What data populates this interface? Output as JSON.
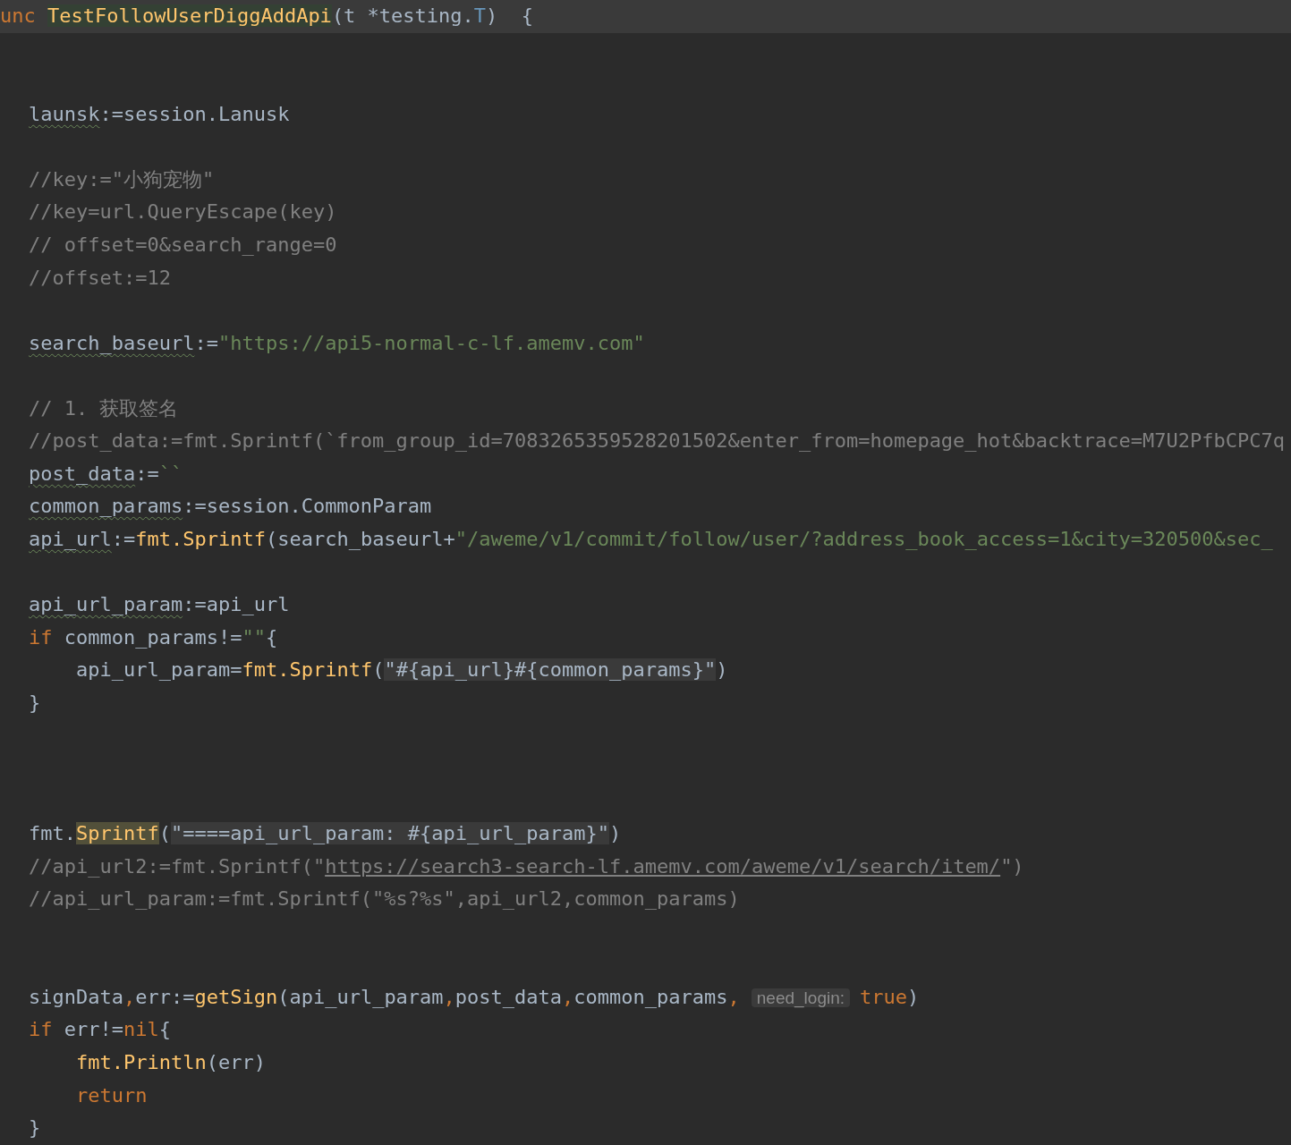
{
  "editor": {
    "lines": [
      {
        "kind": "code",
        "current": true,
        "tokens": [
          {
            "kind": "keyword",
            "text": "unc"
          },
          {
            "kind": "func-decl",
            "text": "TestFollowUserDiggAddApi"
          },
          {
            "kind": "plain",
            "text": "(t *testing."
          },
          {
            "kind": "type",
            "text": "T"
          },
          {
            "kind": "plain",
            "text": ")  {"
          }
        ],
        "children": [
          {
            "kind": "blank"
          },
          {
            "kind": "blank"
          },
          {
            "kind": "code",
            "tokens": [
              {
                "kind": "var-warn",
                "text": "launsk"
              },
              {
                "kind": "plain",
                "text": ":=session.Lanusk"
              }
            ]
          },
          {
            "kind": "blank"
          },
          {
            "kind": "code",
            "tokens": [
              {
                "kind": "comment",
                "text": "//key:=\"小狗宠物\""
              }
            ]
          },
          {
            "kind": "code",
            "tokens": [
              {
                "kind": "comment",
                "text": "//key=url.QueryEscape(key)"
              }
            ]
          },
          {
            "kind": "code",
            "tokens": [
              {
                "kind": "comment",
                "text": "// offset=0&search_range=0"
              }
            ]
          },
          {
            "kind": "code",
            "tokens": [
              {
                "kind": "comment",
                "text": "//offset:=12"
              }
            ]
          },
          {
            "kind": "blank"
          },
          {
            "kind": "code",
            "tokens": [
              {
                "kind": "var-warn",
                "text": "search_baseurl"
              },
              {
                "kind": "plain",
                "text": ":="
              },
              {
                "kind": "string",
                "text": "\"https://api5-normal-c-lf.amemv.com\""
              }
            ]
          },
          {
            "kind": "blank"
          },
          {
            "kind": "code",
            "tokens": [
              {
                "kind": "comment",
                "text": "// 1. 获取签名"
              }
            ]
          },
          {
            "kind": "code",
            "tokens": [
              {
                "kind": "comment",
                "text": "//post_data:=fmt.Sprintf(`from_group_id=7083265359528201502&enter_from=homepage_hot&backtrace=M7U2PfbCPC7q"
              }
            ]
          },
          {
            "kind": "code",
            "tokens": [
              {
                "kind": "var-warn",
                "text": "post_data"
              },
              {
                "kind": "plain",
                "text": ":="
              },
              {
                "kind": "string",
                "text": "``"
              }
            ]
          },
          {
            "kind": "code",
            "tokens": [
              {
                "kind": "var-warn",
                "text": "common_params"
              },
              {
                "kind": "plain",
                "text": ":=session.CommonParam"
              }
            ]
          },
          {
            "kind": "code",
            "tokens": [
              {
                "kind": "var-warn",
                "text": "api_url"
              },
              {
                "kind": "plain",
                "text": ":="
              },
              {
                "kind": "func",
                "text": "fmt.Sprintf"
              },
              {
                "kind": "plain",
                "text": "(search_baseurl+"
              },
              {
                "kind": "string",
                "text": "\"/aweme/v1/commit/follow/user/?address_book_access=1&city=320500&sec_"
              }
            ]
          },
          {
            "kind": "blank"
          },
          {
            "kind": "code",
            "tokens": [
              {
                "kind": "var-warn",
                "text": "api_url_param"
              },
              {
                "kind": "plain",
                "text": ":=api_url"
              }
            ]
          },
          {
            "kind": "code",
            "tokens": [
              {
                "kind": "keyword",
                "text": "if"
              },
              {
                "kind": "plain",
                "text": " common_params!="
              },
              {
                "kind": "string",
                "text": "\"\""
              },
              {
                "kind": "plain",
                "text": "{"
              }
            ],
            "children": [
              {
                "kind": "code",
                "tokens": [
                  {
                    "kind": "plain",
                    "text": "api_url_param="
                  },
                  {
                    "kind": "func",
                    "text": "fmt.Sprintf"
                  },
                  {
                    "kind": "plain",
                    "text": "("
                  },
                  {
                    "kind": "string-injected",
                    "text": "\"#{api_url}#{common_params}\""
                  },
                  {
                    "kind": "plain",
                    "text": ")"
                  }
                ]
              }
            ]
          },
          {
            "kind": "code",
            "tokens": [
              {
                "kind": "plain",
                "text": "}"
              }
            ]
          },
          {
            "kind": "blank"
          },
          {
            "kind": "blank"
          },
          {
            "kind": "blank"
          },
          {
            "kind": "code",
            "tokens": [
              {
                "kind": "plain",
                "text": "fmt."
              },
              {
                "kind": "func-usage",
                "text": "Sprintf"
              },
              {
                "kind": "plain",
                "text": "("
              },
              {
                "kind": "string-injected",
                "text": "\"====api_url_param: #{api_url_param}\""
              },
              {
                "kind": "plain",
                "text": ")"
              }
            ]
          },
          {
            "kind": "code",
            "tokens": [
              {
                "kind": "comment",
                "text": "//api_url2:=fmt.Sprintf(\""
              },
              {
                "kind": "comment-link",
                "text": "https://search3-search-lf.amemv.com/aweme/v1/search/item/"
              },
              {
                "kind": "comment",
                "text": "\")"
              }
            ]
          },
          {
            "kind": "code",
            "tokens": [
              {
                "kind": "comment",
                "text": "//api_url_param:=fmt.Sprintf(\"%s?%s\",api_url2,common_params)"
              }
            ]
          },
          {
            "kind": "blank"
          },
          {
            "kind": "blank"
          },
          {
            "kind": "code",
            "tokens": [
              {
                "kind": "plain",
                "text": "signData"
              },
              {
                "kind": "punct",
                "text": ","
              },
              {
                "kind": "plain",
                "text": "err:="
              },
              {
                "kind": "func",
                "text": "getSign"
              },
              {
                "kind": "plain",
                "text": "(api_url_param"
              },
              {
                "kind": "punct",
                "text": ","
              },
              {
                "kind": "plain",
                "text": "post_data"
              },
              {
                "kind": "punct",
                "text": ","
              },
              {
                "kind": "plain",
                "text": "common_params"
              },
              {
                "kind": "punct",
                "text": ","
              },
              {
                "kind": "hint",
                "text": "need_login:"
              },
              {
                "kind": "keyword",
                "text": "true"
              },
              {
                "kind": "plain",
                "text": ")"
              }
            ]
          },
          {
            "kind": "code",
            "tokens": [
              {
                "kind": "keyword",
                "text": "if"
              },
              {
                "kind": "plain",
                "text": " err!="
              },
              {
                "kind": "keyword",
                "text": "nil"
              },
              {
                "kind": "plain",
                "text": "{"
              }
            ],
            "children": [
              {
                "kind": "code",
                "tokens": [
                  {
                    "kind": "func",
                    "text": "fmt.Println"
                  },
                  {
                    "kind": "plain",
                    "text": "(err)"
                  }
                ]
              },
              {
                "kind": "code",
                "tokens": [
                  {
                    "kind": "keyword",
                    "text": "return"
                  }
                ]
              }
            ]
          },
          {
            "kind": "code",
            "tokens": [
              {
                "kind": "plain",
                "text": "}"
              }
            ]
          }
        ]
      }
    ]
  }
}
